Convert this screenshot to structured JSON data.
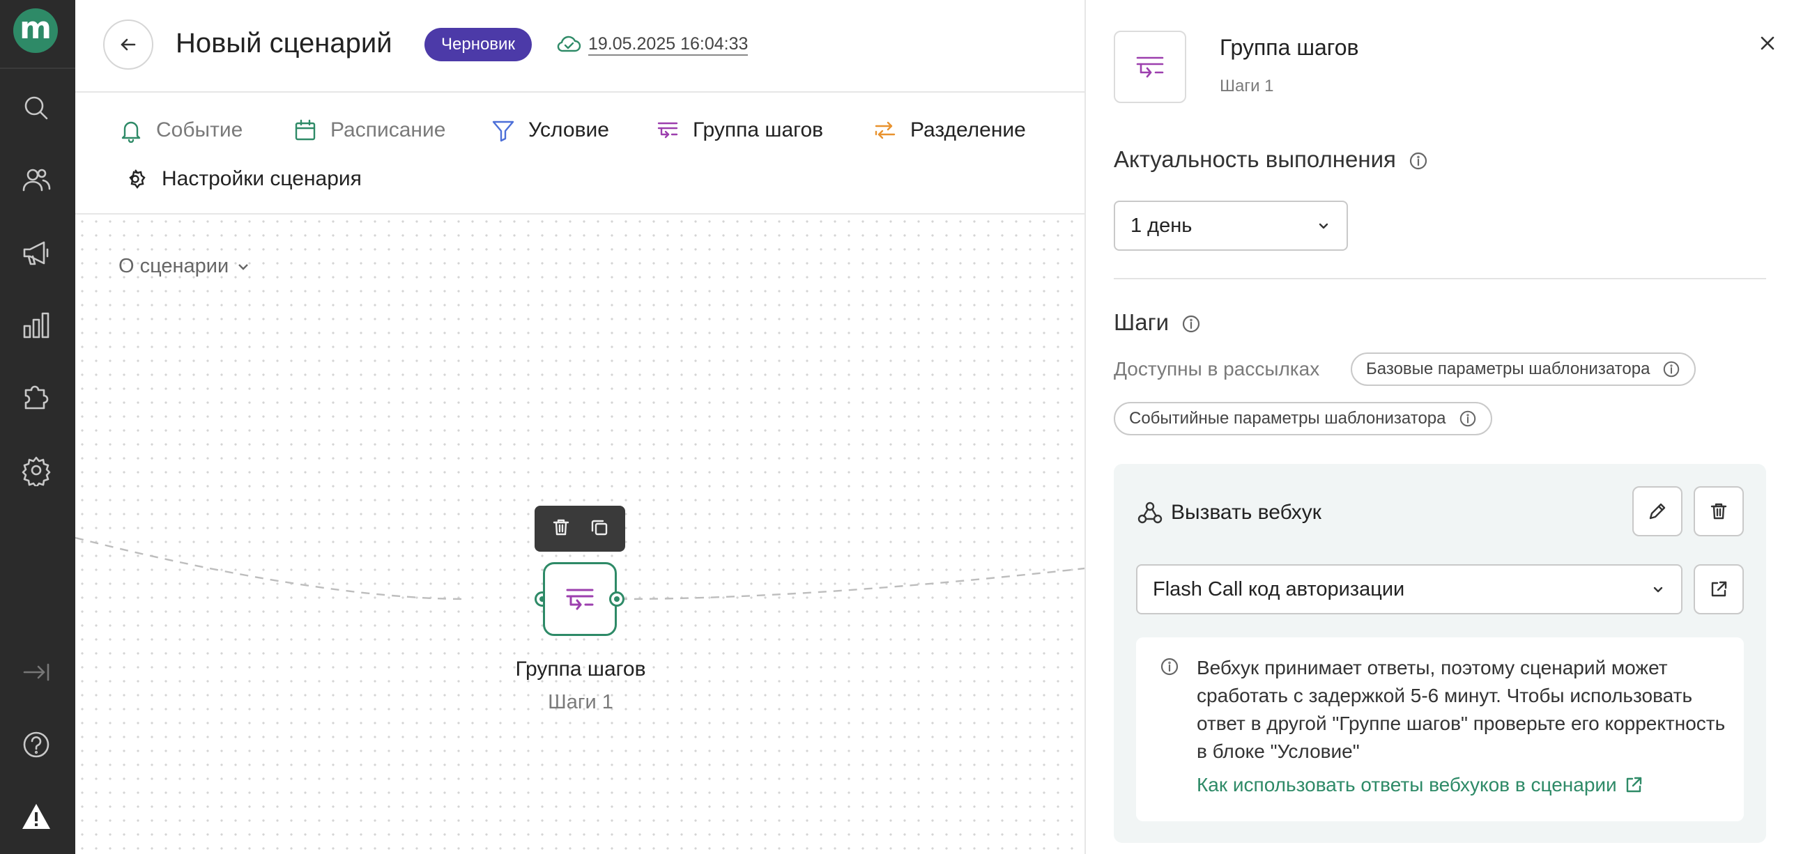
{
  "app": {
    "logo_letter": "m"
  },
  "header": {
    "title": "Новый сценарий",
    "status_badge": "Черновик",
    "saved_at": "19.05.2025 16:04:33"
  },
  "toolbar": {
    "items": [
      {
        "label": "Событие",
        "icon": "bell-icon",
        "color": "#2e8a67"
      },
      {
        "label": "Расписание",
        "icon": "calendar-icon",
        "color": "#2e8a67"
      },
      {
        "label": "Условие",
        "icon": "filter-icon",
        "color": "#4c6fd8"
      },
      {
        "label": "Группа шагов",
        "icon": "step-group-icon",
        "color": "#9c3fae"
      },
      {
        "label": "Разделение",
        "icon": "split-icon",
        "color": "#e8922e"
      }
    ],
    "settings_label": "Настройки сценария"
  },
  "canvas": {
    "about_label": "О сценарии",
    "node": {
      "title": "Группа шагов",
      "subtitle": "Шаги 1"
    }
  },
  "panel": {
    "title": "Группа шагов",
    "subtitle": "Шаги 1",
    "relevance": {
      "heading": "Актуальность выполнения",
      "selected": "1 день"
    },
    "steps": {
      "heading": "Шаги",
      "available_label": "Доступны в рассылках",
      "chips": [
        "Базовые параметры шаблонизатора",
        "Событийные параметры шаблонизатора"
      ]
    },
    "step": {
      "title": "Вызвать вебхук",
      "webhook_selected": "Flash Call код авторизации",
      "notice": "Вебхук принимает ответы, поэтому сценарий может сработать с задержкой 5-6 минут. Чтобы использовать ответ в другой \"Группе шагов\" проверьте его корректность в блоке \"Условие\"",
      "link": "Как использовать ответы вебхуков в сценарии"
    }
  },
  "colors": {
    "accent": "#2e8a67",
    "badge": "#4c3aa8",
    "step_group": "#9c3fae",
    "rail": "#2b2b2b"
  }
}
